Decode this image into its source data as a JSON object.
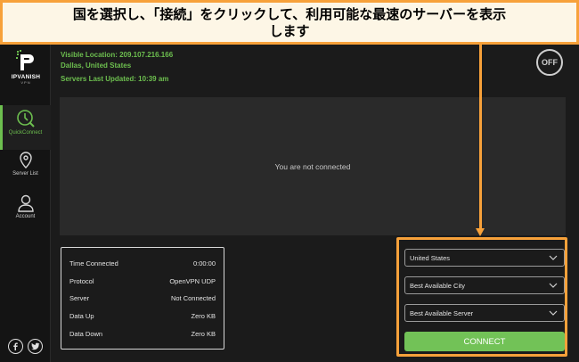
{
  "annotation": {
    "line1": "国を選択し、「接続」をクリックして、利用可能な最速のサーバーを表示",
    "line2": "します"
  },
  "app": {
    "brand": "IPVANISH",
    "brand_sub": "VPN"
  },
  "sidebar": {
    "items": [
      {
        "label": "QuickConnect",
        "icon": "quickconnect-icon",
        "active": true
      },
      {
        "label": "Server List",
        "icon": "location-pin-icon",
        "active": false
      },
      {
        "label": "Account",
        "icon": "user-icon",
        "active": false
      }
    ],
    "social": [
      "facebook-icon",
      "twitter-icon"
    ]
  },
  "header": {
    "visible_location": "Visible Location: 209.107.216.166",
    "city": "Dallas, United States",
    "servers_updated": "Servers Last Updated: 10:39 am",
    "toggle_label": "OFF"
  },
  "main": {
    "status_text": "You are not connected"
  },
  "stats": [
    {
      "label": "Time Connected",
      "value": "0:00:00"
    },
    {
      "label": "Protocol",
      "value": "OpenVPN UDP"
    },
    {
      "label": "Server",
      "value": "Not Connected"
    },
    {
      "label": "Data Up",
      "value": "Zero KB"
    },
    {
      "label": "Data Down",
      "value": "Zero KB"
    }
  ],
  "controls": {
    "country": "United States",
    "city": "Best Available City",
    "server": "Best Available Server",
    "connect_label": "CONNECT"
  },
  "colors": {
    "accent_green": "#6dbf4f",
    "annotation_orange": "#f7a13a",
    "background": "#1b1b1b",
    "panel": "#2a2a2a"
  }
}
